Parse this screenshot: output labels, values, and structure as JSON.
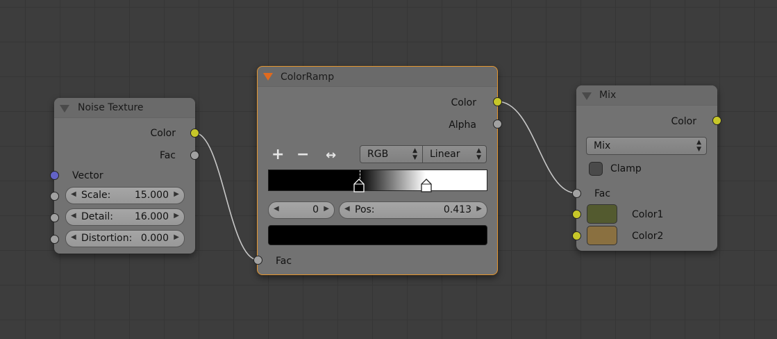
{
  "noise_node": {
    "title": "Noise Texture",
    "outputs": {
      "color": "Color",
      "fac": "Fac"
    },
    "input_vector": "Vector",
    "scale_label": "Scale:",
    "scale_value": "15.000",
    "detail_label": "Detail:",
    "detail_value": "16.000",
    "distortion_label": "Distortion:",
    "distortion_value": "0.000"
  },
  "colorramp_node": {
    "title": "ColorRamp",
    "outputs": {
      "color": "Color",
      "alpha": "Alpha"
    },
    "add_symbol": "+",
    "remove_symbol": "−",
    "flip_symbol": "↔",
    "color_mode": "RGB",
    "interpolation": "Linear",
    "active_index": "0",
    "pos_label": "Pos:",
    "pos_value": "0.413",
    "input_fac": "Fac",
    "stops": [
      0.413,
      0.72
    ],
    "stop_colors": [
      "#000000",
      "#ffffff"
    ],
    "active_color": "#000000"
  },
  "mix_node": {
    "title": "Mix",
    "output_color": "Color",
    "blend_mode": "Mix",
    "clamp_label": "Clamp",
    "clamp_checked": false,
    "input_fac": "Fac",
    "color1_label": "Color1",
    "color2_label": "Color2",
    "color1_swatch": "#535a2f",
    "color2_swatch": "#8a7040"
  },
  "colors": {
    "socket_color": "#c7c729",
    "socket_float": "#a1a1a1",
    "socket_vector": "#6363c7",
    "selected_outline": "#e6962d",
    "colorramp_triangle": "#e06a1e"
  }
}
